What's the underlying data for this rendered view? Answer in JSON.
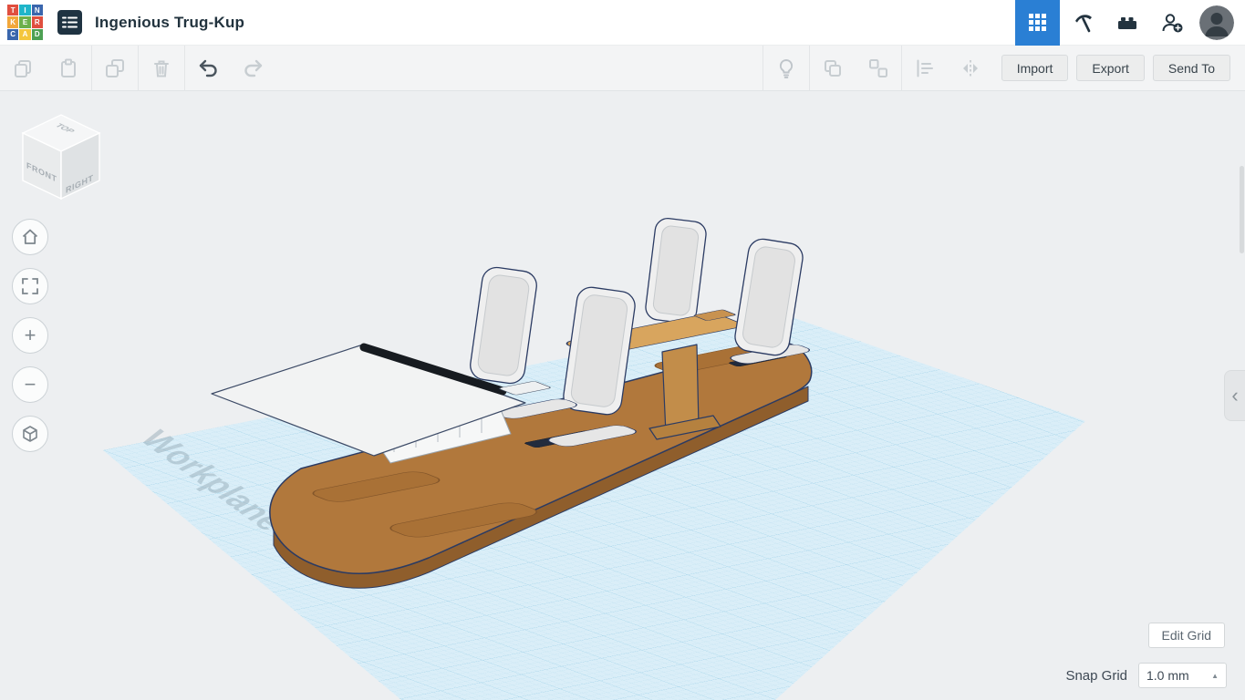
{
  "app": {
    "title": "Ingenious Trug-Kup"
  },
  "logo_tiles": [
    {
      "ch": "T",
      "bg": "#e04f3f"
    },
    {
      "ch": "I",
      "bg": "#1fb5c9"
    },
    {
      "ch": "N",
      "bg": "#3a66ad"
    },
    {
      "ch": "K",
      "bg": "#f2a73b"
    },
    {
      "ch": "E",
      "bg": "#6cb04b"
    },
    {
      "ch": "R",
      "bg": "#e04f3f"
    },
    {
      "ch": "C",
      "bg": "#3a66ad"
    },
    {
      "ch": "A",
      "bg": "#f4c63c"
    },
    {
      "ch": "D",
      "bg": "#4da053"
    }
  ],
  "toolbar": {
    "import": "Import",
    "export": "Export",
    "send_to": "Send To"
  },
  "viewcube": {
    "top": "TOP",
    "front": "FRONT",
    "right": "RIGHT"
  },
  "workplane": {
    "watermark": "Workplane"
  },
  "grid_controls": {
    "edit_grid": "Edit Grid",
    "snap_label": "Snap Grid",
    "snap_value": "1.0 mm"
  },
  "icons": {
    "zoom_in": "+",
    "zoom_out": "−",
    "panel_collapse": "‹",
    "snap_caret": "▲"
  },
  "colors": {
    "accent_blue": "#2a7fd4",
    "workplane_blue": "#daeef8",
    "deck_brown": "#b1783c",
    "outline_navy": "#2b3b63"
  }
}
